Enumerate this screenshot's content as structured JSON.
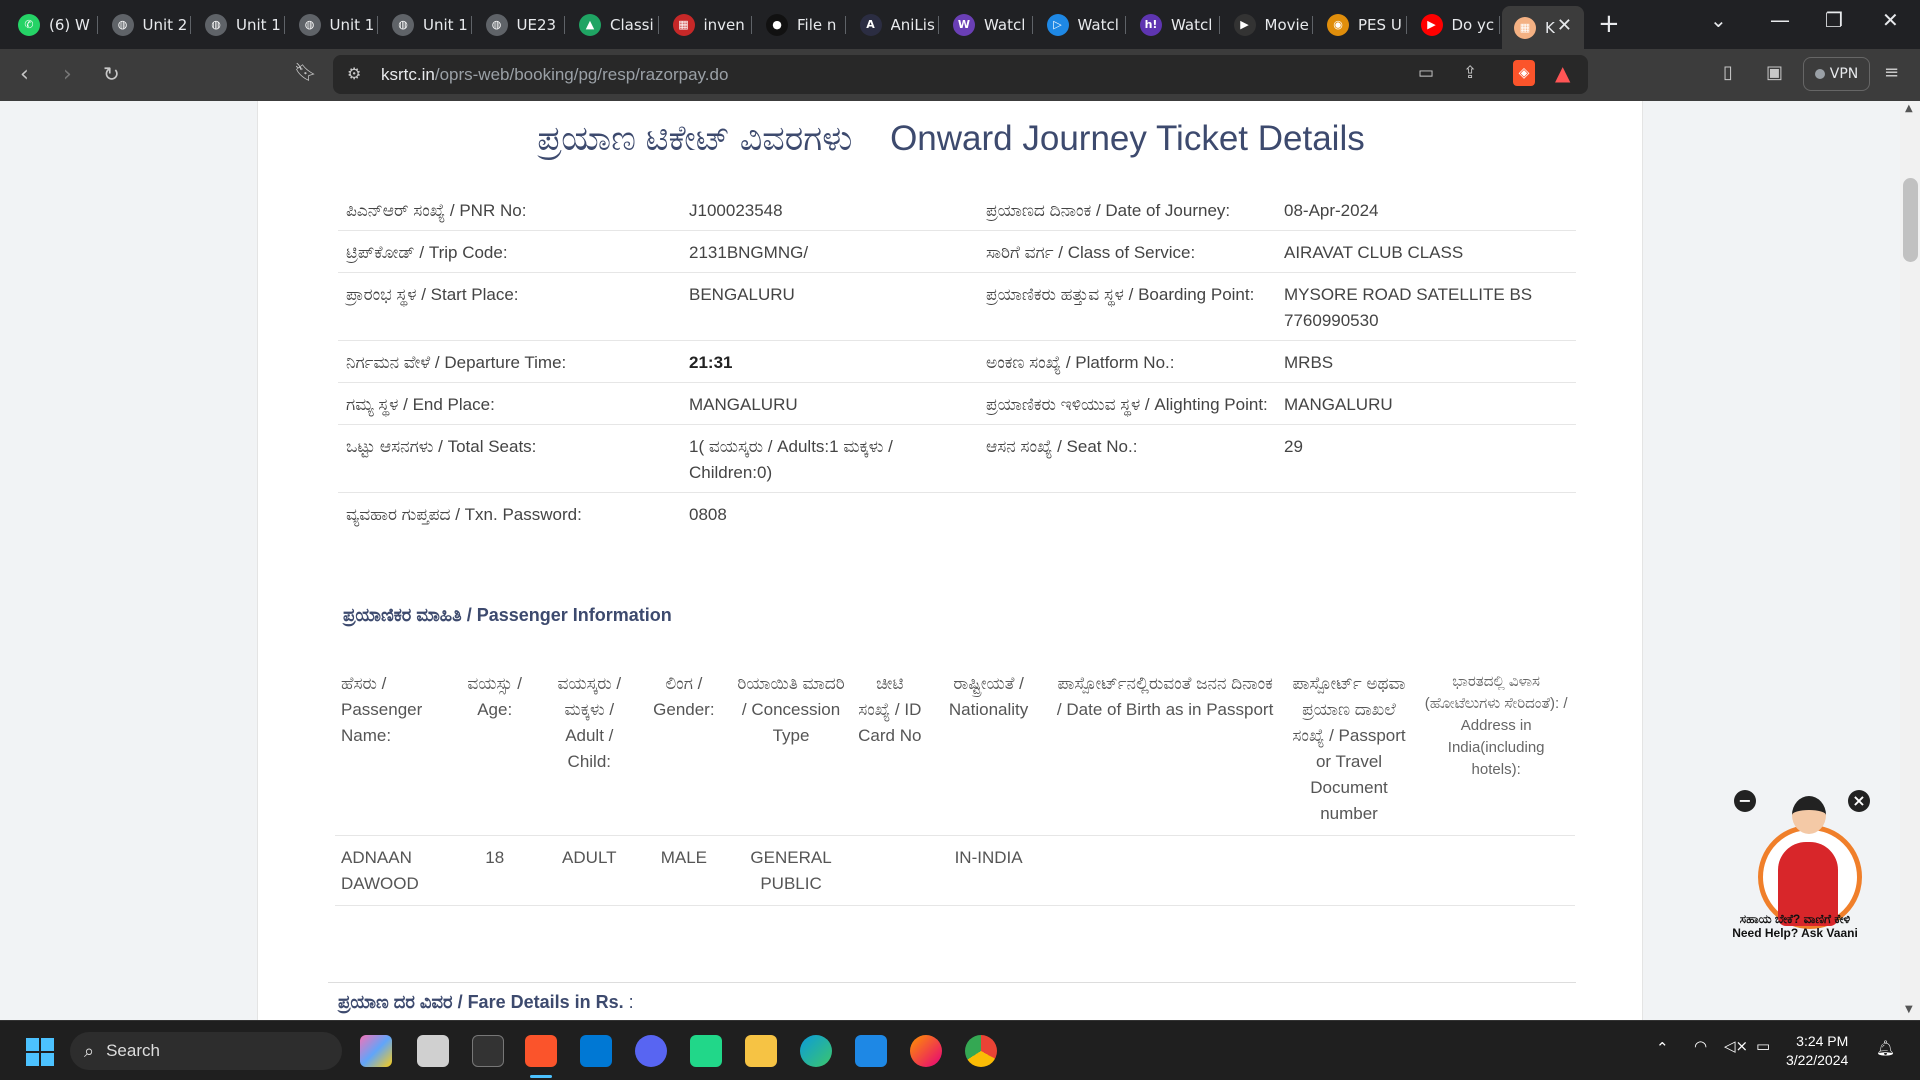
{
  "browser": {
    "tabs": [
      {
        "title": "(6) W",
        "icon": "whatsapp-icon",
        "color": "#25d366",
        "glyph": "✆"
      },
      {
        "title": "Unit 2",
        "icon": "globe-icon",
        "color": "#5f6368",
        "glyph": "◍"
      },
      {
        "title": "Unit 1",
        "icon": "globe-icon",
        "color": "#5f6368",
        "glyph": "◍"
      },
      {
        "title": "Unit 1",
        "icon": "globe-icon",
        "color": "#5f6368",
        "glyph": "◍"
      },
      {
        "title": "Unit 1",
        "icon": "globe-icon",
        "color": "#5f6368",
        "glyph": "◍"
      },
      {
        "title": "UE23",
        "icon": "globe-icon",
        "color": "#5f6368",
        "glyph": "◍"
      },
      {
        "title": "Classi",
        "icon": "drive-icon",
        "color": "#1fa463",
        "glyph": "▲"
      },
      {
        "title": "inven",
        "icon": "sheet-icon",
        "color": "#c62828",
        "glyph": "▦"
      },
      {
        "title": "File n",
        "icon": "github-icon",
        "color": "#111111",
        "glyph": "●"
      },
      {
        "title": "AniLis",
        "icon": "anilist-icon",
        "color": "#2b2d42",
        "glyph": "A"
      },
      {
        "title": "Watcl",
        "icon": "w-icon",
        "color": "#6a3fb5",
        "glyph": "W"
      },
      {
        "title": "Watcl",
        "icon": "play-icon",
        "color": "#1e88e5",
        "glyph": "▷"
      },
      {
        "title": "Watcl",
        "icon": "h-icon",
        "color": "#5e35b1",
        "glyph": "h!"
      },
      {
        "title": "Movie",
        "icon": "movie-play-icon",
        "color": "#333333",
        "glyph": "▶"
      },
      {
        "title": "PES U",
        "icon": "pes-icon",
        "color": "#e08e0b",
        "glyph": "◉"
      },
      {
        "title": "Do yc",
        "icon": "youtube-icon",
        "color": "#ff0000",
        "glyph": "▶"
      },
      {
        "title": "K",
        "icon": "ksrtc-icon",
        "color": "#f4b183",
        "glyph": "▦"
      }
    ],
    "url_domain": "ksrtc.in",
    "url_path": "/oprs-web/booking/pg/resp/razorpay.do",
    "vpn_label": "VPN"
  },
  "ticket": {
    "heading_kn": "ಪ್ರಯಾಣ ಟಿಕೇಟ್ ವಿವರಗಳು",
    "heading_en": "Onward Journey Ticket Details",
    "rows": [
      {
        "l1": "ಪಿಎನ್‌ಆರ್ ಸಂಖ್ಯೆ / PNR No:",
        "v1": "J100023548",
        "l2": "ಪ್ರಯಾಣದ ದಿನಾಂಕ / Date of Journey:",
        "v2": "08-Apr-2024"
      },
      {
        "l1": "ಟ್ರಿಪ್‌ಕೋಡ್ / Trip Code:",
        "v1": "2131BNGMNG/",
        "l2": "ಸಾರಿಗೆ ವರ್ಗ / Class of Service:",
        "v2": "AIRAVAT CLUB CLASS"
      },
      {
        "l1": "ಪ್ರಾರಂಭ ಸ್ಥಳ / Start Place:",
        "v1": "BENGALURU",
        "l2": "ಪ್ರಯಾಣಿಕರು ಹತ್ತುವ ಸ್ಥಳ / Boarding Point:",
        "v2": "MYSORE ROAD SATELLITE BS 7760990530"
      },
      {
        "l1": "ನಿರ್ಗಮನ ವೇಳೆ / Departure Time:",
        "v1": "21:31",
        "l2": "ಅಂಕಣ ಸಂಖ್ಯೆ / Platform No.:",
        "v2": "MRBS"
      },
      {
        "l1": "ಗಮ್ಯ ಸ್ಥಳ / End Place:",
        "v1": "MANGALURU",
        "l2": "ಪ್ರಯಾಣಿಕರು ಇಳಿಯುವ ಸ್ಥಳ / Alighting Point:",
        "v2": "MANGALURU"
      },
      {
        "l1": "ಒಟ್ಟು ಆಸನಗಳು / Total Seats:",
        "v1": "1( ವಯಸ್ಕರು / Adults:1 ಮಕ್ಕಳು / Children:0)",
        "l2": "ಆಸನ ಸಂಖ್ಯೆ / Seat No.:",
        "v2": "29"
      },
      {
        "l1": "ವ್ಯವಹಾರ ಗುಪ್ತಪದ / Txn. Password:",
        "v1": "0808",
        "l2": "",
        "v2": ""
      }
    ]
  },
  "passenger": {
    "title": "ಪ್ರಯಾಣಿಕರ ಮಾಹಿತಿ / Passenger Information",
    "headers": [
      "ಹೆಸರು / Passenger Name:",
      "ವಯಸ್ಸು / Age:",
      "ವಯಸ್ಕರು / ಮಕ್ಕಳು / Adult / Child:",
      "ಲಿಂಗ / Gender:",
      "ರಿಯಾಯಿತಿ ಮಾದರಿ / Concession Type",
      "ಚೀಟಿ ಸಂಖ್ಯೆ / ID Card No",
      "ರಾಷ್ಟ್ರೀಯತೆ / Nationality",
      "ಪಾಸ್ಪೋರ್ಟ್‌ನಲ್ಲಿರುವಂತೆ ಜನನ ದಿನಾಂಕ / Date of Birth as in Passport",
      "ಪಾಸ್ಪೋರ್ಟ್ ಅಥವಾ ಪ್ರಯಾಣ ದಾಖಲೆ ಸಂಖ್ಯೆ / Passport or Travel Document number",
      "ಭಾರತದಲ್ಲಿ ವಿಳಾಸ (ಹೋಟೆಲುಗಳು ಸೇರಿದಂತೆ): / Address in India(including hotels):"
    ],
    "rows": [
      [
        "ADNAAN DAWOOD",
        "18",
        "ADULT",
        "MALE",
        "GENERAL PUBLIC",
        "",
        "IN-INDIA",
        "",
        "",
        ""
      ]
    ]
  },
  "fare": {
    "title": "ಪ್ರಯಾಣ ದರ ವಿವರ / Fare Details in Rs.",
    "suffix": ":"
  },
  "vaani": {
    "text_kn": "ಸಹಾಯ ಬೇಕೆ? ವಾಣಿಗೆ ಕೇಳಿ",
    "text_en": "Need Help? Ask Vaani"
  },
  "taskbar": {
    "search_placeholder": "Search",
    "time": "3:24 PM",
    "date": "3/22/2024"
  }
}
